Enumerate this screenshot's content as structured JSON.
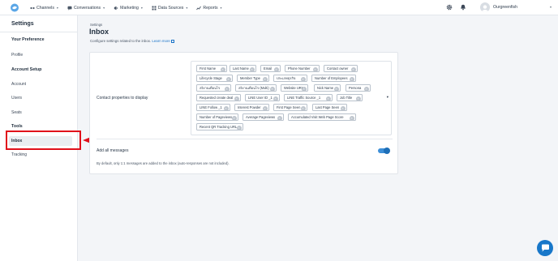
{
  "topnav": {
    "items": [
      {
        "label": "Channels",
        "icon": "channels-icon"
      },
      {
        "label": "Conversations",
        "icon": "chat-icon"
      },
      {
        "label": "Marketing",
        "icon": "megaphone-icon"
      },
      {
        "label": "Data Sources",
        "icon": "grid-icon"
      },
      {
        "label": "Reports",
        "icon": "chart-icon"
      }
    ],
    "account_name": "Ourgreenfish"
  },
  "sidebar": {
    "title": "Settings",
    "sections": [
      {
        "heading": "Your Preference",
        "items": [
          "Profile"
        ]
      },
      {
        "heading": "Account Setup",
        "items": [
          "Account",
          "Users",
          "Seats"
        ]
      },
      {
        "heading": "Tools",
        "items": [
          "Inbox",
          "Tracking"
        ]
      }
    ],
    "active_item": "Inbox"
  },
  "main": {
    "breadcrumb": "Settings",
    "title": "Inbox",
    "subtitle": "Configure settings related to the inbox.",
    "learn_more": "Learn more",
    "contact_props_label": "Contact properties to display",
    "tags": [
      "First Name",
      "Last Name",
      "Email",
      "Phone Number",
      "Contact owner",
      "Lifecycle Stage",
      "Member Type",
      "ประเภทธุรกิจ",
      "Number of Employees",
      "ลงิงานเดือนไร",
      "ลงิงานเดือนไร (Multi)",
      "Website URL",
      "Nick Name",
      "Persona",
      "Requested create deal",
      "LINE User ID _1",
      "LINE Traffic Source _1",
      "Job Title",
      "LINE Follow _1",
      "Interest Powder",
      "First Page Seen",
      "Last Page Seen",
      "Number of Pageviews",
      "Average Pageviews",
      "Accumulated Visit Web Page Score",
      "Recent QR Tracking URL"
    ],
    "add_all_label": "Add all messages",
    "add_all_enabled": true,
    "note": "By default, only 1:1 messages are added to the inbox (auto-responses are not included)."
  },
  "annotation": {
    "color": "#e0101b"
  },
  "colors": {
    "accent": "#1877c9",
    "toggle": "#3d8fd8"
  }
}
